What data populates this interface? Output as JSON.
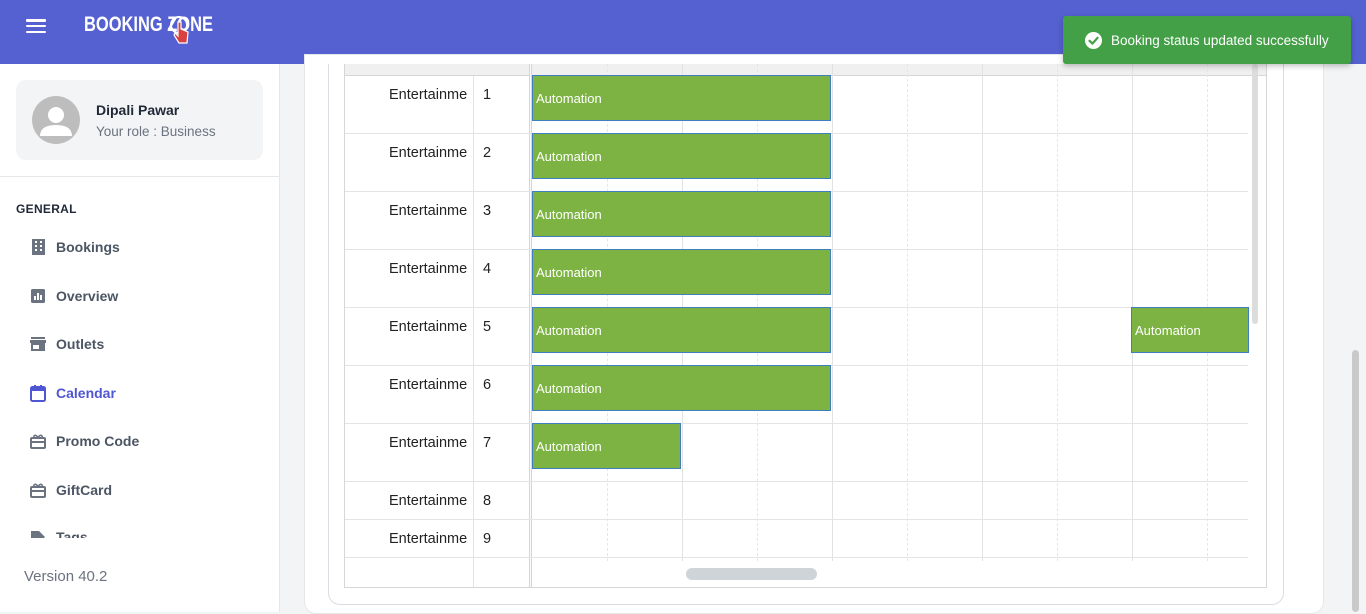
{
  "app": {
    "logo_text": "BOOKING ZONE"
  },
  "user": {
    "name": "Dipali Pawar",
    "role": "Your role : Business"
  },
  "sidebar": {
    "section_title": "GENERAL",
    "items": [
      {
        "label": "Bookings",
        "icon": "building-icon",
        "active": false
      },
      {
        "label": "Overview",
        "icon": "bar-chart-icon",
        "active": false
      },
      {
        "label": "Outlets",
        "icon": "store-icon",
        "active": false
      },
      {
        "label": "Calendar",
        "icon": "calendar-icon",
        "active": true
      },
      {
        "label": "Promo Code",
        "icon": "gift-icon",
        "active": false
      },
      {
        "label": "GiftCard",
        "icon": "gift-card-icon",
        "active": false
      },
      {
        "label": "Tags",
        "icon": "tag-icon",
        "active": false
      }
    ],
    "version": "Version 40.2"
  },
  "colors": {
    "primary": "#5561d1",
    "event": "#7cb342",
    "toast": "#43a047",
    "active_nav": "#4f56d3"
  },
  "scheduler": {
    "resources": [
      {
        "name": "Entertainme",
        "number": "1"
      },
      {
        "name": "Entertainme",
        "number": "2"
      },
      {
        "name": "Entertainme",
        "number": "3"
      },
      {
        "name": "Entertainme",
        "number": "4"
      },
      {
        "name": "Entertainme",
        "number": "5"
      },
      {
        "name": "Entertainme",
        "number": "6"
      },
      {
        "name": "Entertainme",
        "number": "7"
      },
      {
        "name": "Entertainme",
        "number": "8"
      },
      {
        "name": "Entertainme",
        "number": "9"
      }
    ],
    "events": [
      {
        "title": "Automation",
        "resource": 1
      },
      {
        "title": "Automation",
        "resource": 2
      },
      {
        "title": "Automation",
        "resource": 3
      },
      {
        "title": "Automation",
        "resource": 4
      },
      {
        "title": "Automation",
        "resource": 5
      },
      {
        "title": "Automation",
        "resource": 5
      },
      {
        "title": "Automation",
        "resource": 6
      },
      {
        "title": "Automation",
        "resource": 7
      }
    ]
  },
  "toast": {
    "message": "Booking status updated successfully",
    "icon": "check-circle-icon"
  }
}
